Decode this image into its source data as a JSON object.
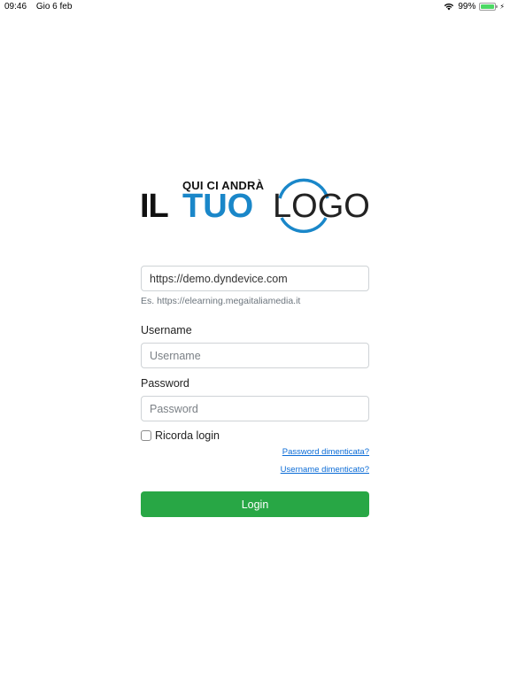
{
  "status_bar": {
    "time": "09:46",
    "date": "Gio 6 feb",
    "battery_percent": "99%",
    "battery_level": 0.99,
    "wifi_icon": "wifi-icon",
    "charging_icon": "bolt-icon"
  },
  "logo": {
    "top_line": "QUI CI ANDRÀ",
    "word1": "IL",
    "word2": "TUO",
    "word3": "LOGO",
    "accent_color": "#1a87c9"
  },
  "form": {
    "server_url_value": "https://demo.dyndevice.com",
    "server_url_hint": "Es. https://elearning.megaitaliamedia.it",
    "username_label": "Username",
    "username_placeholder": "Username",
    "password_label": "Password",
    "password_placeholder": "Password",
    "remember_label": "Ricorda login",
    "forgot_password": "Password dimenticata?",
    "forgot_username": "Username dimenticato?",
    "login_button": "Login",
    "login_button_color": "#28a745"
  }
}
